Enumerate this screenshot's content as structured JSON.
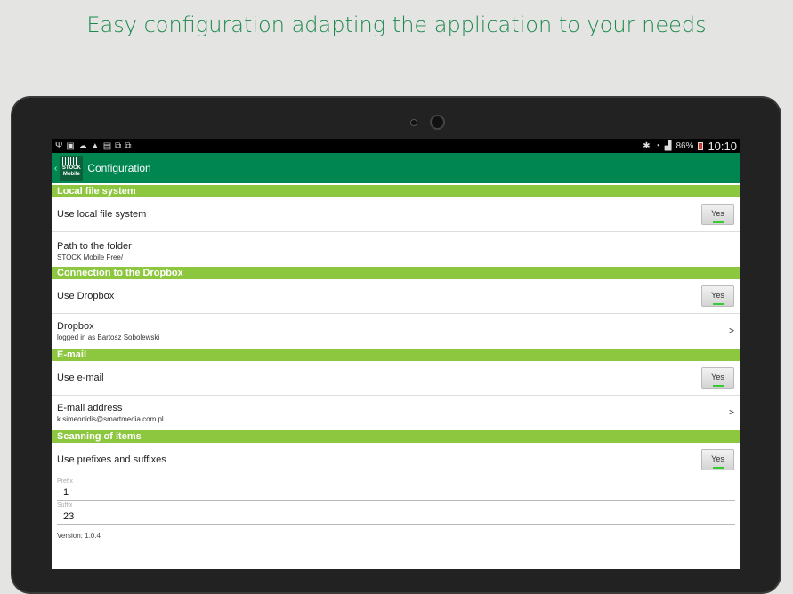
{
  "headline": "Easy configuration adapting the application to your needs",
  "status": {
    "battery": "86%",
    "time": "10:10"
  },
  "appbar": {
    "logo_top": "STOCK",
    "logo_bottom": "Mobile",
    "title": "Configuration"
  },
  "sections": [
    {
      "title": "Local file system",
      "toggle_label": "Use local file system",
      "toggle_value": "Yes",
      "item_label": "Path to the folder",
      "item_sub": "STOCK Mobile Free/"
    },
    {
      "title": "Connection to the Dropbox",
      "toggle_label": "Use Dropbox",
      "toggle_value": "Yes",
      "item_label": "Dropbox",
      "item_sub": "logged in as Bartosz Sobolewski",
      "chevron": ">"
    },
    {
      "title": "E-mail",
      "toggle_label": "Use e-mail",
      "toggle_value": "Yes",
      "item_label": "E-mail address",
      "item_sub": "k.simeonidis@smartmedia.com.pl",
      "chevron": ">"
    },
    {
      "title": "Scanning of items",
      "toggle_label": "Use prefixes and suffixes",
      "toggle_value": "Yes"
    }
  ],
  "prefix": {
    "label": "Prefix",
    "value": "1"
  },
  "suffix": {
    "label": "Suffix",
    "value": "23"
  },
  "version": "Version: 1.0.4"
}
